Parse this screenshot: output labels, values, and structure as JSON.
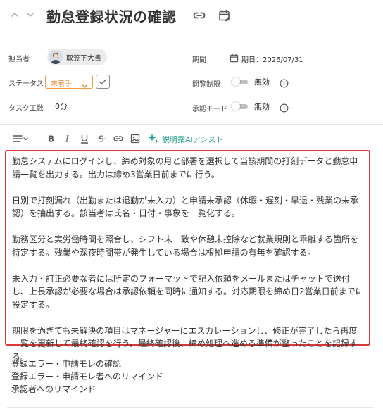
{
  "header": {
    "title": "勤怠登録状況の確認"
  },
  "properties": {
    "assignee_label": "担当者",
    "assignee_name": "取笠下大書",
    "status_label": "ステータス",
    "status_value": "未着手",
    "effort_label": "タスク工数",
    "effort_value": "0分",
    "period_label": "期間",
    "period_value": "期日：2026/07/31",
    "view_restrict_label": "閲覧制限",
    "view_restrict_value": "無効",
    "approval_mode_label": "承認モード",
    "approval_mode_value": "無効"
  },
  "toolbar": {
    "ai_assist_label": "説明案AIアシスト"
  },
  "editor": {
    "paragraphs": [
      "勤怠システムにログインし、締め対象の月と部署を選択して当該期間の打刻データと勤怠申請一覧を出力する。出力は締め3営業日前までに行う。",
      "日別で打刻漏れ（出勤または退勤が未入力）と申請未承認（休暇・遅刻・早退・残業の未承認）を抽出する。該当者は氏名・日付・事象を一覧化する。",
      "勤務区分と実労働時間を照合し、シフト未一致や休憩未控除など就業規則と乖離する箇所を特定する。残業や深夜時間帯が発生している場合は根拠申請の有無を確認する。",
      "未入力・訂正必要な者には所定のフォーマットで記入依頼をメールまたはチャットで送付し、上長承認が必要な場合は承認依頼を同時に通知する。対応期限を締め日2営業日前までに設定する。",
      "期限を過ぎても未解決の項目はマネージャーにエスカレーションし、修正が完了したら再度一覧を更新して最終確認を行う。最終確認後、締め処理へ進める準備が整ったことを記録する。"
    ]
  },
  "notes": [
    "登録エラー・申請モレの確認",
    "登録エラー・申請モレ者へのリマインド",
    "承認者へのリマインド"
  ],
  "colors": {
    "status_accent": "#e8842a",
    "ai_accent": "#27a38f",
    "editor_border": "#d73838"
  }
}
